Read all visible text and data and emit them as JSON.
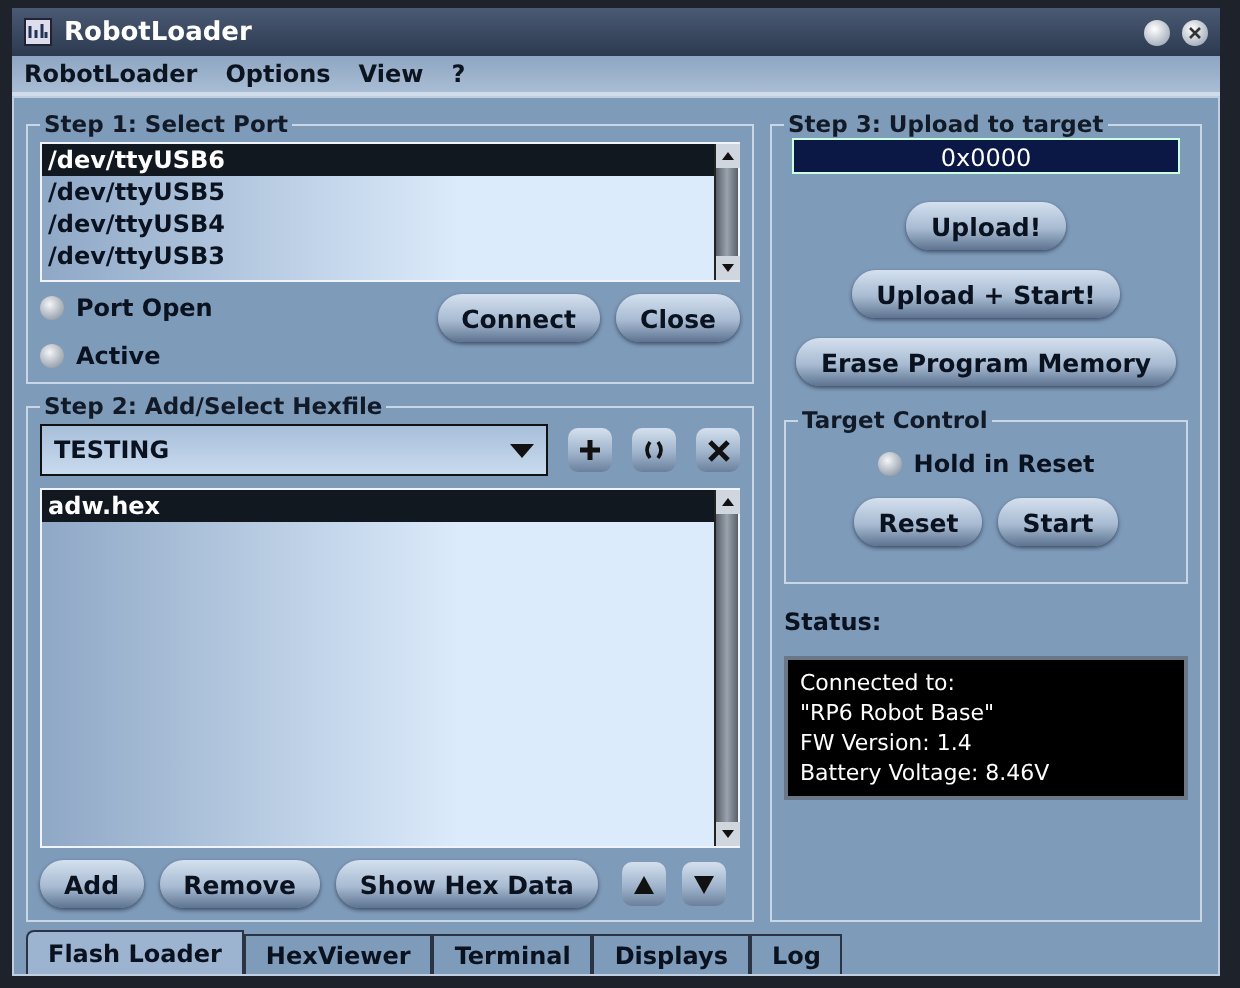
{
  "window": {
    "title": "RobotLoader"
  },
  "menu": [
    "RobotLoader",
    "Options",
    "View",
    "?"
  ],
  "step1": {
    "title": "Step 1: Select Port",
    "ports": [
      {
        "label": "/dev/ttyUSB6",
        "selected": true
      },
      {
        "label": "/dev/ttyUSB5",
        "selected": false
      },
      {
        "label": "/dev/ttyUSB4",
        "selected": false
      },
      {
        "label": "/dev/ttyUSB3",
        "selected": false
      }
    ],
    "indicators": [
      {
        "label": "Port Open",
        "on": false
      },
      {
        "label": "Active",
        "on": false
      }
    ],
    "buttons": [
      "Connect",
      "Close"
    ]
  },
  "step2": {
    "title": "Step 2: Add/Select Hexfile",
    "category": "TESTING",
    "files": [
      {
        "label": "adw.hex",
        "selected": true
      }
    ],
    "buttons": [
      "Add",
      "Remove",
      "Show Hex Data"
    ]
  },
  "step3": {
    "title": "Step 3: Upload to target",
    "address": "0x0000",
    "buttons": [
      "Upload!",
      "Upload + Start!",
      "Erase Program Memory"
    ],
    "target_control": {
      "title": "Target Control",
      "hold_in_reset": {
        "label": "Hold in Reset",
        "on": false
      },
      "buttons": [
        "Reset",
        "Start"
      ]
    },
    "status_label": "Status:",
    "status_lines": [
      "Connected to:",
      "\"RP6 Robot Base\"",
      "FW Version: 1.4",
      "Battery Voltage: 8.46V"
    ]
  },
  "tabs": [
    {
      "label": "Flash Loader",
      "selected": true
    },
    {
      "label": "HexViewer",
      "selected": false
    },
    {
      "label": "Terminal",
      "selected": false
    },
    {
      "label": "Displays",
      "selected": false
    },
    {
      "label": "Log",
      "selected": false
    }
  ]
}
